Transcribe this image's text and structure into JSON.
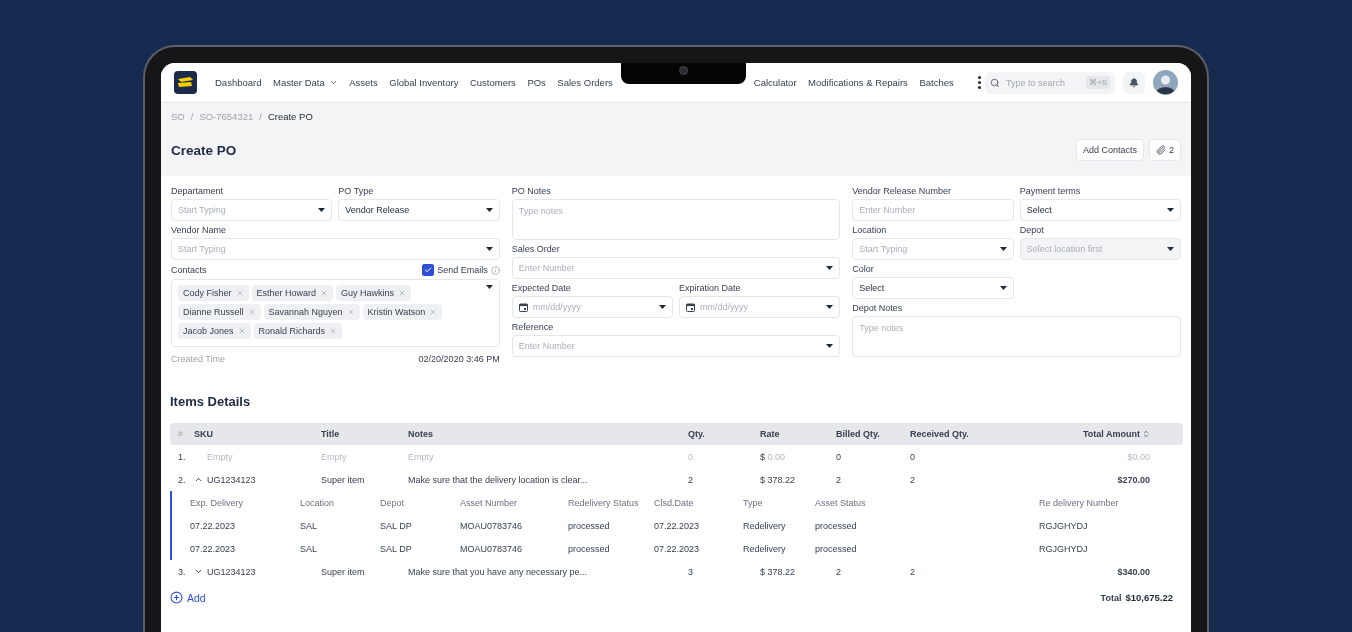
{
  "nav": {
    "items_left": [
      {
        "label": "Dashboard",
        "has_menu": false
      },
      {
        "label": "Master Data",
        "has_menu": true
      },
      {
        "label": "Assets",
        "has_menu": false
      },
      {
        "label": "Global Inventory",
        "has_menu": false
      },
      {
        "label": "Customers",
        "has_menu": false
      },
      {
        "label": "POs",
        "has_menu": false
      },
      {
        "label": "Sales Orders",
        "has_menu": false
      }
    ],
    "items_right": [
      {
        "label": "Calculator",
        "has_menu": false
      },
      {
        "label": "Modifications & Repairs",
        "has_menu": false
      },
      {
        "label": "Batches",
        "has_menu": false
      }
    ],
    "search": {
      "placeholder": "Type to search",
      "shortcut": "⌘+S"
    }
  },
  "breadcrumb": {
    "separator": "/",
    "items": [
      {
        "label": "SO",
        "current": false
      },
      {
        "label": "SO-7654321",
        "current": false
      },
      {
        "label": "Create PO",
        "current": true
      }
    ]
  },
  "page": {
    "title": "Create PO",
    "buttons": [
      {
        "kind": "text",
        "label": "Add Contacts"
      },
      {
        "kind": "attachments",
        "label": "2"
      }
    ]
  },
  "form": {
    "columns": [
      {
        "rows": [
          [
            {
              "kind": "select",
              "label": "Departament",
              "placeholder": "Start Typing",
              "disabled": false
            },
            {
              "kind": "select",
              "label": "PO Type",
              "value": "Vendor Release",
              "disabled": false
            }
          ],
          [
            {
              "kind": "select",
              "label": "Vendor Name",
              "placeholder": "Start Typing",
              "disabled": false
            }
          ],
          [
            {
              "kind": "contacts",
              "label": "Contacts",
              "send_emails": {
                "label": "Send Emails",
                "checked": true
              },
              "tags": [
                "Cody Fisher",
                "Esther Howard",
                "Guy Hawkins",
                "Dianne Russell",
                "Savannah Nguyen",
                "Kristin Watson",
                "Jacob Jones",
                "Ronald Richards"
              ]
            }
          ]
        ],
        "meta": {
          "label": "Created Time",
          "value": "02/20/2020 3:46 PM"
        }
      },
      {
        "rows": [
          [
            {
              "kind": "textarea",
              "label": "PO Notes",
              "placeholder": "Type notes"
            }
          ],
          [
            {
              "kind": "select",
              "label": "Sales Order",
              "placeholder": "Enter Number",
              "disabled": false
            }
          ],
          [
            {
              "kind": "date",
              "label": "Expected Date",
              "placeholder": "mm/dd/yyyy"
            },
            {
              "kind": "date",
              "label": "Expiration Date",
              "placeholder": "mm/dd/yyyy"
            }
          ],
          [
            {
              "kind": "select",
              "label": "Reference",
              "placeholder": "Enter Number",
              "disabled": false
            }
          ]
        ]
      },
      {
        "rows": [
          [
            {
              "kind": "input",
              "label": "Vendor Release Number",
              "placeholder": "Enter Number"
            },
            {
              "kind": "select",
              "label": "Payment terms",
              "value": "Select",
              "disabled": false
            }
          ],
          [
            {
              "kind": "select",
              "label": "Location",
              "placeholder": "Start Typing",
              "disabled": false
            },
            {
              "kind": "select",
              "label": "Depot",
              "placeholder": "Select location first",
              "disabled": true
            }
          ],
          [
            {
              "kind": "select",
              "label": "Color",
              "value": "Select",
              "disabled": false
            },
            {
              "kind": "none"
            }
          ],
          [
            {
              "kind": "textarea",
              "label": "Depot Notes",
              "placeholder": "Type notes"
            }
          ]
        ]
      }
    ]
  },
  "items": {
    "title": "Items Details",
    "columns": [
      {
        "label": "#",
        "sortable": false
      },
      {
        "label": "SKU",
        "sortable": false
      },
      {
        "label": "Title",
        "sortable": false
      },
      {
        "label": "Notes",
        "sortable": false
      },
      {
        "label": "Qty.",
        "sortable": false
      },
      {
        "label": "Rate",
        "sortable": false
      },
      {
        "label": "Billed Qty.",
        "sortable": false
      },
      {
        "label": "Received Qty.",
        "sortable": false
      },
      {
        "label": "Total Amount",
        "sortable": true
      }
    ],
    "rows": [
      {
        "num": "1.",
        "empty": true,
        "sku": "Empty",
        "title": "Empty",
        "notes": "Empty",
        "qty": "0",
        "currency": "$",
        "rate": "0.00",
        "billed": "0",
        "received": "0",
        "total": "$0.00"
      },
      {
        "num": "2.",
        "empty": false,
        "expanded": true,
        "sku": "UG1234123",
        "title": "Super item",
        "notes": "Make sure that the delivery location is clear...",
        "qty": "2",
        "currency": "$",
        "rate": "378.22",
        "billed": "2",
        "received": "2",
        "total": "$270.00",
        "details": {
          "columns": [
            "Exp. Delivery",
            "Location",
            "Depot",
            "Asset Number",
            "Redelivery Status",
            "Clsd.Date",
            "Type",
            "Asset Status",
            "Re delivery Number"
          ],
          "rows": [
            [
              "07.22.2023",
              "SAL",
              "SAL DP",
              "MOAU0783746",
              "processed",
              "07.22.2023",
              "Redelivery",
              "processed",
              "RGJGHYDJ"
            ],
            [
              "07.22.2023",
              "SAL",
              "SAL DP",
              "MOAU0783746",
              "processed",
              "07.22.2023",
              "Redelivery",
              "processed",
              "RGJGHYDJ"
            ]
          ]
        }
      },
      {
        "num": "3.",
        "empty": false,
        "expanded": false,
        "sku": "UG1234123",
        "title": "Super item",
        "notes": "Make sure that you have any necessary pe...",
        "qty": "3",
        "currency": "$",
        "rate": "378.22",
        "billed": "2",
        "received": "2",
        "total": "$340.00"
      }
    ],
    "add_label": "Add",
    "total_label": "Total",
    "total_value": "$10,675.22"
  }
}
